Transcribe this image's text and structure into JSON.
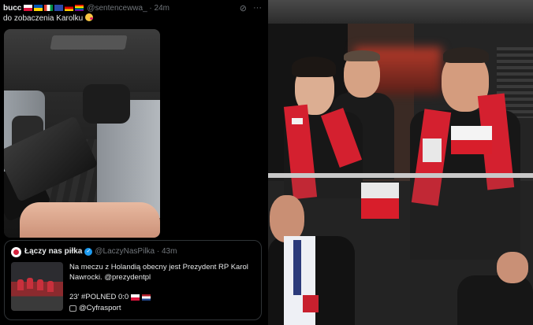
{
  "post": {
    "username": "bucc",
    "handle_time": "@sentencewwa_ · 24m",
    "text": "do zobaczenia Karolku",
    "icons": [
      "grok-icon",
      "more-icon"
    ]
  },
  "quoted_post": {
    "name": "Łączy nas piłka",
    "handle_time": "@LaczyNasPilka · 43m",
    "text": "Na meczu z Holandią obecny jest Prezydent RP Karol Nawrocki. @prezydentpl",
    "score_line": "23' #POLNED 0:0",
    "cyfra_line": "@Cyfrasport"
  },
  "colors": {
    "background": "#000000",
    "text": "#e7e9ea",
    "muted": "#71767b",
    "verified": "#1d9bf0",
    "poland_red": "#d4202f"
  }
}
